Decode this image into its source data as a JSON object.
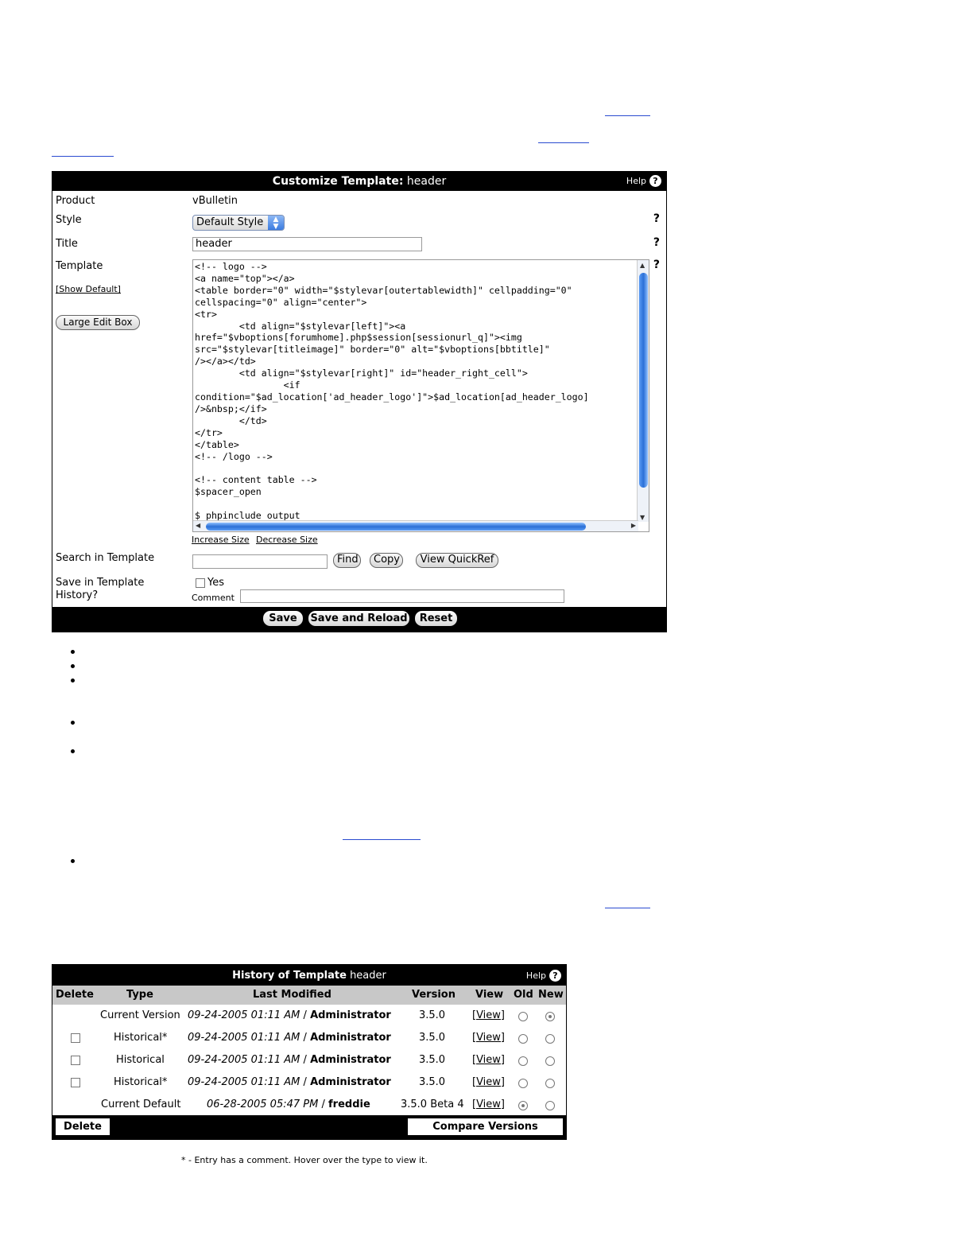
{
  "customize": {
    "title_prefix": "Customize Template:",
    "template_name": "header",
    "help_label": "Help",
    "product_label": "Product",
    "product_value": "vBulletin",
    "style_label": "Style",
    "style_value": "Default Style",
    "title_label": "Title",
    "title_value": "header",
    "template_label": "Template",
    "show_default": "[Show Default]",
    "large_edit_box": "Large Edit Box",
    "template_code": "<!-- logo -->\n<a name=\"top\"></a>\n<table border=\"0\" width=\"$stylevar[outertablewidth]\" cellpadding=\"0\"\ncellspacing=\"0\" align=\"center\">\n<tr>\n        <td align=\"$stylevar[left]\"><a\nhref=\"$vboptions[forumhome].php$session[sessionurl_q]\"><img\nsrc=\"$stylevar[titleimage]\" border=\"0\" alt=\"$vboptions[bbtitle]\"\n/></a></td>\n        <td align=\"$stylevar[right]\" id=\"header_right_cell\">\n                <if\ncondition=\"$ad_location['ad_header_logo']\">$ad_location[ad_header_logo]\n/>&nbsp;</if>\n        </td>\n</tr>\n</table>\n<!-- /logo -->\n\n<!-- content table -->\n$spacer_open\n\n$_phpinclude_output",
    "increase_size": "Increase Size",
    "decrease_size": "Decrease Size",
    "search_label": "Search in Template",
    "find_button": "Find",
    "copy_button": "Copy",
    "quickref_button": "View QuickRef",
    "save_history_label_1": "Save in Template",
    "save_history_label_2": "History?",
    "yes_label": "Yes",
    "comment_label": "Comment",
    "qmark": "?",
    "save_button": "Save",
    "save_reload_button": "Save and Reload",
    "reset_button": "Reset"
  },
  "history": {
    "title_prefix": "History of Template",
    "template_name": "header",
    "help_label": "Help",
    "columns": [
      "Delete",
      "Type",
      "Last Modified",
      "Version",
      "View",
      "Old",
      "New"
    ],
    "rows": [
      {
        "type": "Current Version",
        "date": "09-24-2005 01:11 AM",
        "user": "Administrator",
        "version": "3.5.0",
        "view": "[View]"
      },
      {
        "type": "Historical*",
        "date": "09-24-2005 01:11 AM",
        "user": "Administrator",
        "version": "3.5.0",
        "view": "[View]"
      },
      {
        "type": "Historical",
        "date": "09-24-2005 01:11 AM",
        "user": "Administrator",
        "version": "3.5.0",
        "view": "[View]"
      },
      {
        "type": "Historical*",
        "date": "09-24-2005 01:11 AM",
        "user": "Administrator",
        "version": "3.5.0",
        "view": "[View]"
      },
      {
        "type": "Current Default",
        "date": "06-28-2005 05:47 PM",
        "user": "freddie",
        "version": "3.5.0 Beta 4",
        "view": "[View]"
      }
    ],
    "separator": "/",
    "delete_button": "Delete",
    "compare_button": "Compare Versions",
    "footnote": "* - Entry has a comment. Hover over the type to view it."
  }
}
